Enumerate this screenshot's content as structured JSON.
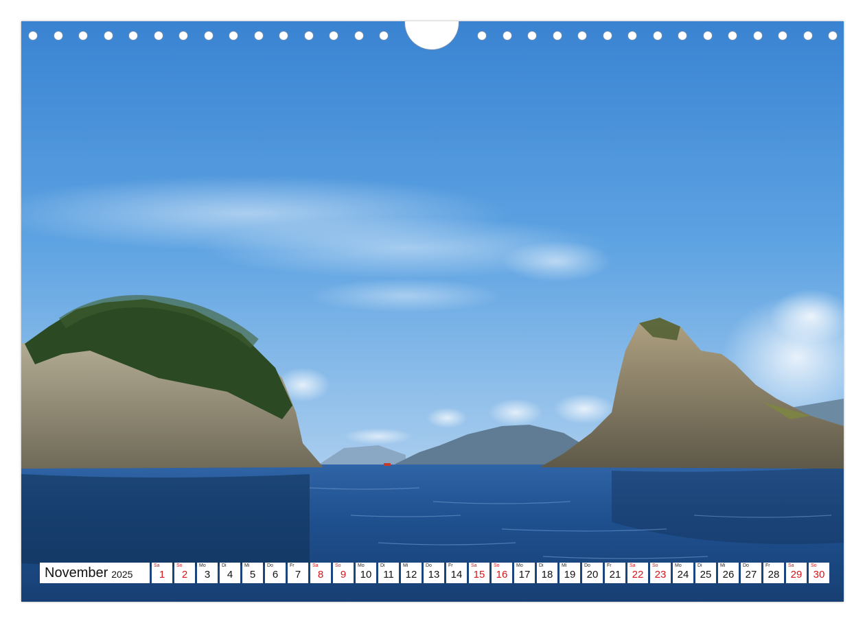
{
  "calendar": {
    "month": "November",
    "year": "2025",
    "days": [
      {
        "wd": "Sa",
        "num": "1",
        "weekend": true
      },
      {
        "wd": "So",
        "num": "2",
        "weekend": true
      },
      {
        "wd": "Mo",
        "num": "3",
        "weekend": false
      },
      {
        "wd": "Di",
        "num": "4",
        "weekend": false
      },
      {
        "wd": "Mi",
        "num": "5",
        "weekend": false
      },
      {
        "wd": "Do",
        "num": "6",
        "weekend": false
      },
      {
        "wd": "Fr",
        "num": "7",
        "weekend": false
      },
      {
        "wd": "Sa",
        "num": "8",
        "weekend": true
      },
      {
        "wd": "So",
        "num": "9",
        "weekend": true
      },
      {
        "wd": "Mo",
        "num": "10",
        "weekend": false
      },
      {
        "wd": "Di",
        "num": "11",
        "weekend": false
      },
      {
        "wd": "Mi",
        "num": "12",
        "weekend": false
      },
      {
        "wd": "Do",
        "num": "13",
        "weekend": false
      },
      {
        "wd": "Fr",
        "num": "14",
        "weekend": false
      },
      {
        "wd": "Sa",
        "num": "15",
        "weekend": true
      },
      {
        "wd": "So",
        "num": "16",
        "weekend": true
      },
      {
        "wd": "Mo",
        "num": "17",
        "weekend": false
      },
      {
        "wd": "Di",
        "num": "18",
        "weekend": false
      },
      {
        "wd": "Mi",
        "num": "19",
        "weekend": false
      },
      {
        "wd": "Do",
        "num": "20",
        "weekend": false
      },
      {
        "wd": "Fr",
        "num": "21",
        "weekend": false
      },
      {
        "wd": "Sa",
        "num": "22",
        "weekend": true
      },
      {
        "wd": "So",
        "num": "23",
        "weekend": true
      },
      {
        "wd": "Mo",
        "num": "24",
        "weekend": false
      },
      {
        "wd": "Di",
        "num": "25",
        "weekend": false
      },
      {
        "wd": "Mi",
        "num": "26",
        "weekend": false
      },
      {
        "wd": "Do",
        "num": "27",
        "weekend": false
      },
      {
        "wd": "Fr",
        "num": "28",
        "weekend": false
      },
      {
        "wd": "Sa",
        "num": "29",
        "weekend": true
      },
      {
        "wd": "So",
        "num": "30",
        "weekend": true
      }
    ]
  },
  "colors": {
    "weekend": "#d8141b",
    "sky_top": "#3a86d4",
    "sea": "#1e4f8f"
  }
}
